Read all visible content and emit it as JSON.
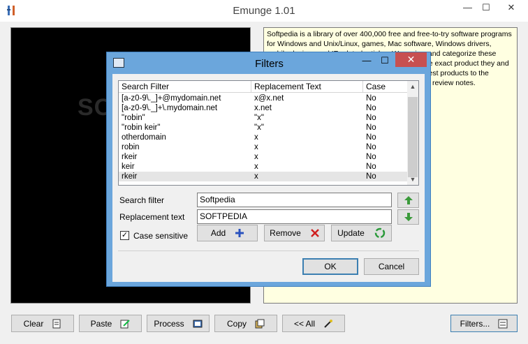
{
  "main_window": {
    "title": "Emunge 1.01",
    "controls": {
      "minimize": "—",
      "maximize": "☐",
      "close": "✕"
    }
  },
  "left_panel": {
    "watermark": "SOFTPEDIA"
  },
  "text_panel": {
    "content": "Softpedia is a library of over 400,000 free and free-to-try software programs for Windows and Unix/Linux, games, Mac software, Windows drivers, mobile devices and IT-related articles. We review and categorize these products in order to allow the visitor/user to find the exact product they and their system needs. We strive to deliver only the best products to the visitor/user together with self-made evaluation and review notes."
  },
  "bottom_buttons": {
    "clear": "Clear",
    "paste": "Paste",
    "process": "Process",
    "copy": "Copy",
    "all": "<< All",
    "filters": "Filters..."
  },
  "dialog": {
    "title": "Filters",
    "controls": {
      "minimize": "—",
      "maximize": "☐",
      "close": "✕"
    },
    "columns": [
      "Search Filter",
      "Replacement Text",
      "Case"
    ],
    "rows": [
      {
        "search": "[a-z0-9\\._]+@mydomain.net",
        "replacement": "x@x.net",
        "case": "No"
      },
      {
        "search": "[a-z0-9\\._]+\\.mydomain.net",
        "replacement": "x.net",
        "case": "No"
      },
      {
        "search": "\"robin\"",
        "replacement": "\"x\"",
        "case": "No"
      },
      {
        "search": "\"robin keir\"",
        "replacement": "\"x\"",
        "case": "No"
      },
      {
        "search": "otherdomain",
        "replacement": "x",
        "case": "No"
      },
      {
        "search": "robin",
        "replacement": "x",
        "case": "No"
      },
      {
        "search": "rkeir",
        "replacement": "x",
        "case": "No"
      },
      {
        "search": "keir",
        "replacement": "x",
        "case": "No"
      },
      {
        "search": "rkeir",
        "replacement": "x",
        "case": "No"
      }
    ],
    "search_filter_label": "Search filter",
    "search_filter_value": "Softpedia",
    "replacement_label": "Replacement text",
    "replacement_value": "SOFTPEDIA",
    "case_sensitive_label": "Case sensitive",
    "case_sensitive_checked": true,
    "add_label": "Add",
    "remove_label": "Remove",
    "update_label": "Update",
    "ok_label": "OK",
    "cancel_label": "Cancel"
  },
  "colors": {
    "dialog_frame": "#6ba6dc",
    "close_red": "#c75050",
    "text_panel_bg": "#ffffe1",
    "arrow_green": "#3a9a3a"
  }
}
